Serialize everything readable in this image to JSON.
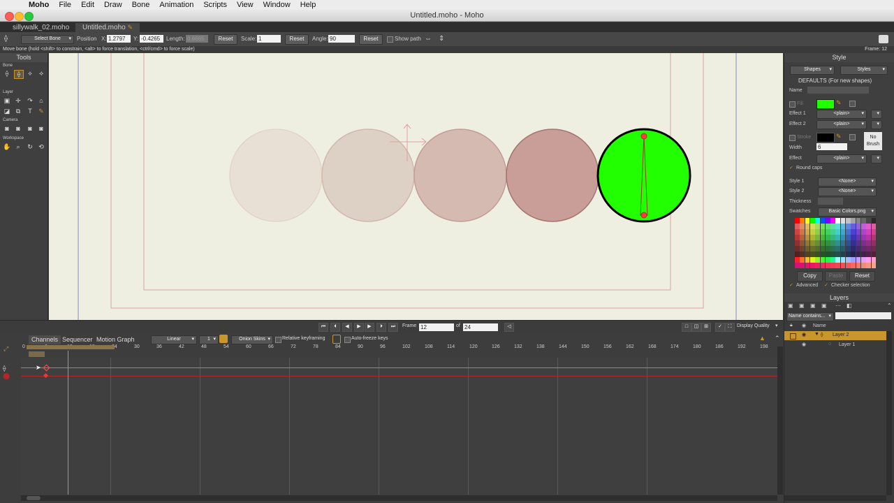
{
  "menubar": {
    "app": "Moho",
    "items": [
      "File",
      "Edit",
      "Draw",
      "Bone",
      "Animation",
      "Scripts",
      "View",
      "Window",
      "Help"
    ]
  },
  "window": {
    "title": "Untitled.moho - Moho"
  },
  "doc_tabs": [
    "sillywalk_02.moho",
    "Untitled.moho"
  ],
  "toolbar": {
    "select_bone": "Select Bone",
    "position_label": "Position",
    "x_label": "X:",
    "x_value": "1.2797",
    "y_label": "Y:",
    "y_value": "-0.4265",
    "length_label": "Length:",
    "length_value": "0.6665",
    "reset_label": "Reset",
    "scale_label": "Scale:",
    "scale_value": "1",
    "angle_label": "Angle:",
    "angle_value": "90",
    "show_path": "Show path",
    "frame_label": "Frame: 12"
  },
  "status": {
    "hint": "Move bone (hold <shift> to constrain, <alt> to force translation, <ctrl/cmd> to force scale)"
  },
  "tools_panel": {
    "title": "Tools",
    "sections": {
      "bone": "Bone",
      "layer": "Layer",
      "camera": "Camera",
      "workspace": "Workspace"
    }
  },
  "playback": {
    "frame_label": "Frame",
    "frame_value": "12",
    "of_label": "of",
    "total_frames": "24",
    "display_quality": "Display Quality"
  },
  "timeline": {
    "tabs": [
      "Channels",
      "Sequencer",
      "Motion Graph"
    ],
    "interpolation": "Linear",
    "interp_step": "1",
    "onion_skins": "Onion Skins",
    "relative_keyframing": "Relative keyframing",
    "auto_freeze": "Auto-freeze keys",
    "frame_numbers": [
      "0",
      "6",
      "12",
      "18",
      "24",
      "30",
      "36",
      "42",
      "48",
      "54",
      "60",
      "66",
      "72",
      "78",
      "84",
      "90",
      "96",
      "102",
      "108",
      "114",
      "120",
      "126",
      "132",
      "138",
      "144",
      "150",
      "156",
      "162",
      "168",
      "174",
      "180",
      "186",
      "192",
      "198"
    ]
  },
  "style_panel": {
    "title": "Style",
    "shapes_dropdown": "Shapes",
    "styles_dropdown": "Styles",
    "defaults_label": "DEFAULTS (For new shapes)",
    "name_label": "Name",
    "fill_label": "Fill",
    "effect1_label": "Effect 1",
    "effect1_value": "<plain>",
    "effect2_label": "Effect 2",
    "effect2_value": "<plain>",
    "stroke_label": "Stroke",
    "no_brush": "No Brush",
    "width_label": "Width",
    "width_value": "6",
    "effect_label": "Effect",
    "effect_value": "<plain>",
    "round_caps": "Round caps",
    "style1_label": "Style 1",
    "style1_value": "<None>",
    "style2_label": "Style 2",
    "style2_value": "<None>",
    "thickness_label": "Thickness",
    "swatches_label": "Swatches",
    "swatches_value": "Basic Colors.png",
    "copy_label": "Copy",
    "paste_label": "Paste",
    "reset_label": "Reset",
    "advanced_label": "Advanced",
    "checker_label": "Checker selection",
    "fill_color": "#22ff00",
    "stroke_color": "#000000"
  },
  "layers_panel": {
    "title": "Layers",
    "filter": "Name contains...",
    "name_header": "Name",
    "layers": [
      "Layer 2",
      "Layer 1"
    ]
  },
  "colors": {
    "accent": "#c8962a",
    "onion": [
      "#e8e0d4",
      "#ddd0c4",
      "#d4bab0",
      "#c99e98"
    ],
    "current_fill": "#22ff00"
  }
}
